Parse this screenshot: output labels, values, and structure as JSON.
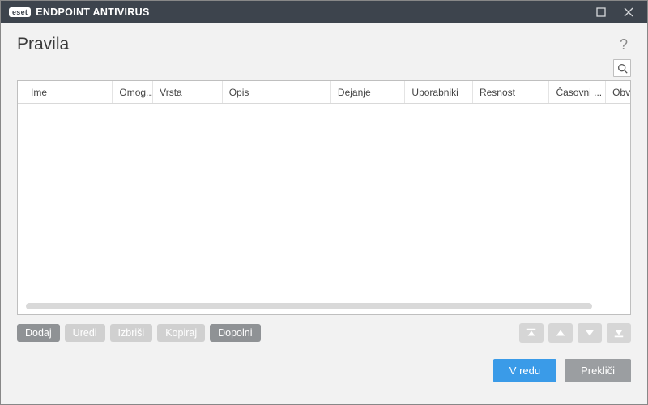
{
  "titlebar": {
    "brand_badge": "eset",
    "brand_text": "ENDPOINT ANTIVIRUS"
  },
  "page": {
    "title": "Pravila",
    "help_symbol": "?"
  },
  "columns": {
    "ime": "Ime",
    "omog": "Omog...",
    "vrsta": "Vrsta",
    "opis": "Opis",
    "dejanje": "Dejanje",
    "uporabniki": "Uporabniki",
    "resnost": "Resnost",
    "casovni": "Časovni ...",
    "obv": "Obv"
  },
  "rows": [],
  "toolbar": {
    "dodaj": "Dodaj",
    "uredi": "Uredi",
    "izbrisi": "Izbriši",
    "kopiraj": "Kopiraj",
    "dopolni": "Dopolni"
  },
  "footer": {
    "ok": "V redu",
    "cancel": "Prekliči"
  }
}
